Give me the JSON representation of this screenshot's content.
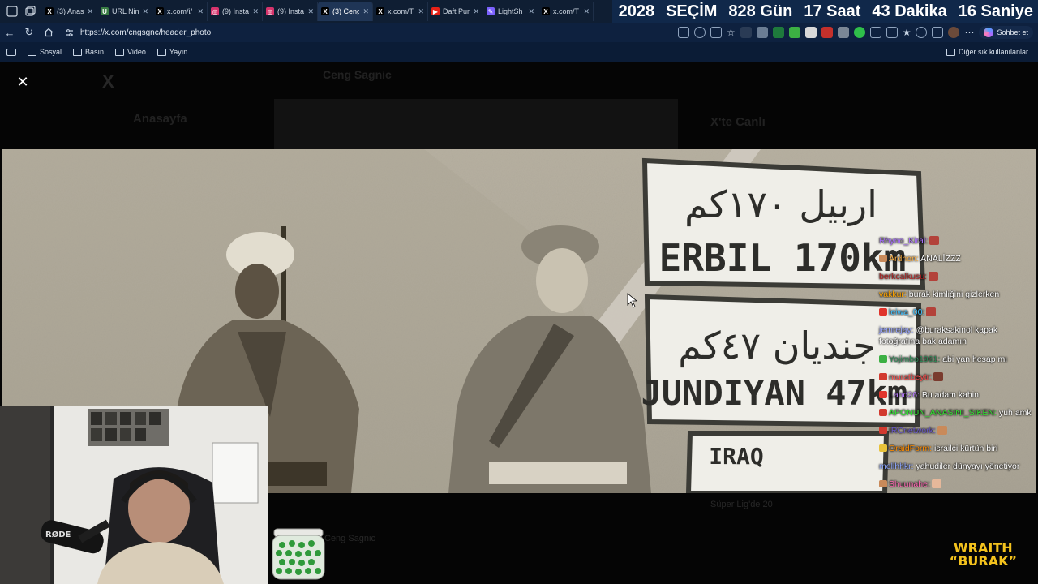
{
  "tabs": [
    {
      "label": "(3) Anas",
      "icon": "x-icon",
      "active": false
    },
    {
      "label": "URL Nin",
      "icon": "url-icon",
      "active": false
    },
    {
      "label": "x.com/i/",
      "icon": "x-icon",
      "active": false
    },
    {
      "label": "(9) Insta",
      "icon": "instagram-icon",
      "active": false
    },
    {
      "label": "(9) Insta",
      "icon": "instagram-icon",
      "active": false
    },
    {
      "label": "(3) Ceng",
      "icon": "x-icon",
      "active": true
    },
    {
      "label": "x.com/T",
      "icon": "x-icon",
      "active": false
    },
    {
      "label": "Daft Pun",
      "icon": "youtube-icon",
      "active": false
    },
    {
      "label": "LightSh",
      "icon": "feather-icon",
      "active": false
    },
    {
      "label": "x.com/T",
      "icon": "x-icon",
      "active": false
    }
  ],
  "countdown": {
    "year": "2028",
    "label": "SEÇİM",
    "days": "828 Gün",
    "hours": "17 Saat",
    "minutes": "43 Dakika",
    "seconds": "16 Saniye"
  },
  "address": {
    "url": "https://x.com/cngsgnc/header_photo",
    "chat_button": "Sohbet et"
  },
  "bookmarks": {
    "items": [
      "Sosyal",
      "Basın",
      "Video",
      "Yayın"
    ],
    "other": "Diğer sık kullanılanlar"
  },
  "background_page": {
    "profile_name": "Ceng Sagnic",
    "home": "Anasayfa",
    "live": "X'te Canlı",
    "trend": "Süper Lig'de 20",
    "author": "Ceng Sagnic"
  },
  "photo": {
    "sign_erbil": "ERBIL 170km",
    "sign_erbil_arabic": "اربيل ١٧٠كم",
    "sign_jundiyan": "JUNDIYAN 47km",
    "sign_jundiyan_arabic": "جنديان ٤٧كم",
    "sign_iraq": "IRAQ"
  },
  "chat": [
    {
      "user": "Rhyno_Kiral:",
      "text": "",
      "user_color": "#a970ff",
      "badge_color": "",
      "emote_color": "#b3423a"
    },
    {
      "user": "Ardhon:",
      "text": "ANALİZZZ",
      "user_color": "#ffb347",
      "badge_color": "#c98a5a",
      "emote_color": ""
    },
    {
      "user": "berkcalkusu:",
      "text": "",
      "user_color": "#b22222",
      "badge_color": "",
      "emote_color": "#b3423a"
    },
    {
      "user": "vakkur:",
      "text": "burak kimliğini gizlerken",
      "user_color": "#ffa500",
      "badge_color": "",
      "emote_color": ""
    },
    {
      "user": "leiwa_00:",
      "text": "",
      "user_color": "#3ec1ff",
      "badge_color": "#e0342c",
      "emote_color": "#b3423a"
    },
    {
      "user": "jemrejay:",
      "text": "@buraksakinol kapak fotoğrafına bak adamın",
      "user_color": "#9aa7ff",
      "badge_color": "",
      "emote_color": ""
    },
    {
      "user": "Yojimbo1961:",
      "text": "abi yan hesap mı",
      "user_color": "#2e8b57",
      "badge_color": "#3cb043",
      "emote_color": ""
    },
    {
      "user": "muratbeytr:",
      "text": "",
      "user_color": "#ff4d4d",
      "badge_color": "#d23a2f",
      "emote_color": "#7a3b2e"
    },
    {
      "user": "Land26:",
      "text": "Bu adam kahin",
      "user_color": "#b97dff",
      "badge_color": "#e0342c",
      "emote_color": ""
    },
    {
      "user": "APONUN_ANASINI_SIKEN:",
      "text": "yuh amk",
      "user_color": "#31e831",
      "badge_color": "#d23a2f",
      "emote_color": ""
    },
    {
      "user": "IRCnetwork:",
      "text": "",
      "user_color": "#6a5acd",
      "badge_color": "#d23a2f",
      "emote_color": "#c98a5a"
    },
    {
      "user": "OraidForm:",
      "text": "israilci kürtün biri",
      "user_color": "#ff8c00",
      "badge_color": "#e8c23a",
      "emote_color": ""
    },
    {
      "user": "melihhkr:",
      "text": "yahudiler dünyayı yönetiyor",
      "user_color": "#8fa8ff",
      "badge_color": "",
      "emote_color": ""
    },
    {
      "user": "Shuunahe:",
      "text": "",
      "user_color": "#ff69b4",
      "badge_color": "#c98a5a",
      "emote_color": "#e6b89a"
    }
  ],
  "overlay": {
    "brand_line1": "WRAITH",
    "brand_line2": "“BURAK”",
    "mic_label": "RØDE"
  },
  "colors": {
    "accent": "#1f3556",
    "chrome": "#0e213f",
    "brand": "#f3c21d"
  }
}
